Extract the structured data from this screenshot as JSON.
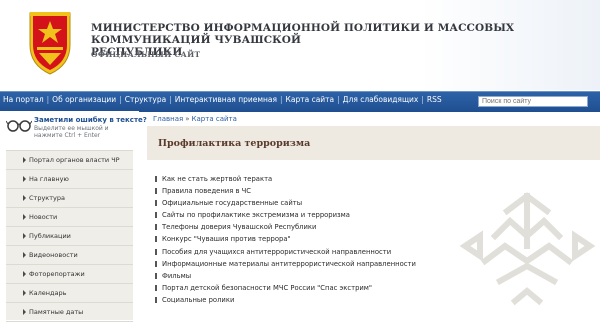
{
  "header": {
    "title_line1": "МИНИСТЕРСТВО ИНФОРМАЦИОННОЙ ПОЛИТИКИ И МАССОВЫХ КОММУНИКАЦИЙ ЧУВАШСКОЙ",
    "title_line2": "РЕСПУБЛИКИ",
    "subtitle": "ОФИЦИАЛЬНЫЙ САЙТ"
  },
  "nav": {
    "items": [
      "На портал",
      "Об организации",
      "Структура",
      "Интерактивная приемная",
      "Карта сайта",
      "Для слабовидящих",
      "RSS"
    ],
    "search_placeholder": "Поиск по сайту"
  },
  "error_box": {
    "title": "Заметили ошибку в тексте?",
    "text": "Выделите ее мышкой и нажмите Ctrl + Enter"
  },
  "sidebar": {
    "items": [
      "Портал органов власти ЧР",
      "На главную",
      "Структура",
      "Новости",
      "Публикации",
      "Видеоновости",
      "Фоторепортажи",
      "Календарь",
      "Памятные даты"
    ]
  },
  "breadcrumb": {
    "home": "Главная",
    "current": "Карта сайта",
    "separator": "»"
  },
  "page": {
    "title": "Профилактика терроризма",
    "links": [
      "Как не стать жертвой теракта",
      "Правила поведения в ЧС",
      "Официальные государственные сайты",
      "Сайты по профилактике экстремизма и терроризма",
      "Телефоны доверия Чувашской Республики",
      "Конкурс \"Чувашия против террора\"",
      "Пособия для учащихся антитеррористической направленности",
      "Информационные материалы антитеррористической направленности",
      "Фильмы",
      "Портал детской безопасности МЧС России \"Спас экстрим\"",
      "Социальные ролики"
    ]
  },
  "colors": {
    "nav_bg": "#2d63a8",
    "title_box_bg": "#eeeae1",
    "menu_bg": "#efeee8",
    "emblem_red": "#d4121a",
    "emblem_gold": "#f2c21c"
  }
}
